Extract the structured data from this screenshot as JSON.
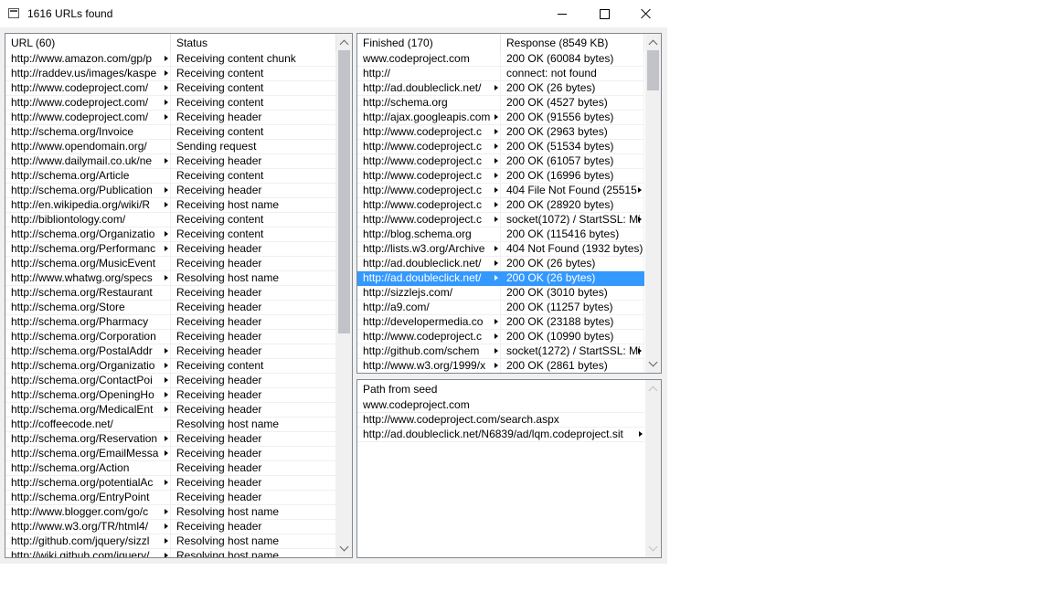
{
  "window": {
    "title": "1616 URLs found"
  },
  "in_progress": {
    "headers": [
      "URL (60)",
      "Status"
    ],
    "rows": [
      {
        "url": "http://www.amazon.com/gp/p",
        "status": "Receiving content chunk"
      },
      {
        "url": "http://raddev.us/images/kaspe",
        "status": "Receiving content"
      },
      {
        "url": "http://www.codeproject.com/",
        "status": "Receiving content"
      },
      {
        "url": "http://www.codeproject.com/",
        "status": "Receiving content"
      },
      {
        "url": "http://www.codeproject.com/",
        "status": "Receiving header"
      },
      {
        "url": "http://schema.org/Invoice",
        "status": "Receiving content"
      },
      {
        "url": "http://www.opendomain.org/",
        "status": "Sending request"
      },
      {
        "url": "http://www.dailymail.co.uk/ne",
        "status": "Receiving header"
      },
      {
        "url": "http://schema.org/Article",
        "status": "Receiving content"
      },
      {
        "url": "http://schema.org/Publication",
        "status": "Receiving header"
      },
      {
        "url": "http://en.wikipedia.org/wiki/R",
        "status": "Receiving host name"
      },
      {
        "url": "http://bibliontology.com/",
        "status": "Receiving content"
      },
      {
        "url": "http://schema.org/Organizatio",
        "status": "Receiving content"
      },
      {
        "url": "http://schema.org/Performanc",
        "status": "Receiving header"
      },
      {
        "url": "http://schema.org/MusicEvent",
        "status": "Receiving header"
      },
      {
        "url": "http://www.whatwg.org/specs",
        "status": "Resolving host name"
      },
      {
        "url": "http://schema.org/Restaurant",
        "status": "Receiving header"
      },
      {
        "url": "http://schema.org/Store",
        "status": "Receiving header"
      },
      {
        "url": "http://schema.org/Pharmacy",
        "status": "Receiving header"
      },
      {
        "url": "http://schema.org/Corporation",
        "status": "Receiving header"
      },
      {
        "url": "http://schema.org/PostalAddr",
        "status": "Receiving header"
      },
      {
        "url": "http://schema.org/Organizatio",
        "status": "Receiving content"
      },
      {
        "url": "http://schema.org/ContactPoi",
        "status": "Receiving header"
      },
      {
        "url": "http://schema.org/OpeningHo",
        "status": "Receiving header"
      },
      {
        "url": "http://schema.org/MedicalEnt",
        "status": "Receiving header"
      },
      {
        "url": "http://coffeecode.net/",
        "status": "Resolving host name"
      },
      {
        "url": "http://schema.org/Reservation",
        "status": "Receiving header"
      },
      {
        "url": "http://schema.org/EmailMessa",
        "status": "Receiving header"
      },
      {
        "url": "http://schema.org/Action",
        "status": "Receiving header"
      },
      {
        "url": "http://schema.org/potentialAc",
        "status": "Receiving header"
      },
      {
        "url": "http://schema.org/EntryPoint",
        "status": "Receiving header"
      },
      {
        "url": "http://www.blogger.com/go/c",
        "status": "Resolving host name"
      },
      {
        "url": "http://www.w3.org/TR/html4/",
        "status": "Receiving header"
      },
      {
        "url": "http://github.com/jquery/sizzl",
        "status": "Resolving host name"
      },
      {
        "url": "http://wiki.github.com/jquery/",
        "status": "Resolving host name"
      }
    ]
  },
  "finished": {
    "headers": [
      "Finished (170)",
      "Response (8549 KB)"
    ],
    "rows": [
      {
        "url": "www.codeproject.com",
        "response": "200 OK (60084 bytes)"
      },
      {
        "url": "http://",
        "response": "connect: not found"
      },
      {
        "url": "http://ad.doubleclick.net/",
        "response": "200 OK (26 bytes)"
      },
      {
        "url": "http://schema.org",
        "response": "200 OK (4527 bytes)"
      },
      {
        "url": "http://ajax.googleapis.com",
        "response": "200 OK (91556 bytes)"
      },
      {
        "url": "http://www.codeproject.c",
        "response": "200 OK (2963 bytes)"
      },
      {
        "url": "http://www.codeproject.c",
        "response": "200 OK (51534 bytes)"
      },
      {
        "url": "http://www.codeproject.c",
        "response": "200 OK (61057 bytes)"
      },
      {
        "url": "http://www.codeproject.c",
        "response": "200 OK (16996 bytes)"
      },
      {
        "url": "http://www.codeproject.c",
        "response": "404 File Not Found (25515"
      },
      {
        "url": "http://www.codeproject.c",
        "response": "200 OK (28920 bytes)"
      },
      {
        "url": "http://www.codeproject.c",
        "response": "socket(1072) / StartSSL: Mi"
      },
      {
        "url": "http://blog.schema.org",
        "response": "200 OK (115416 bytes)"
      },
      {
        "url": "http://lists.w3.org/Archive",
        "response": "404 Not Found (1932 bytes)"
      },
      {
        "url": "http://ad.doubleclick.net/",
        "response": "200 OK (26 bytes)"
      },
      {
        "url": "http://ad.doubleclick.net/",
        "response": "200 OK (26 bytes)"
      },
      {
        "url": "http://sizzlejs.com/",
        "response": "200 OK (3010 bytes)"
      },
      {
        "url": "http://a9.com/",
        "response": "200 OK (11257 bytes)"
      },
      {
        "url": "http://developermedia.co",
        "response": "200 OK (23188 bytes)"
      },
      {
        "url": "http://www.codeproject.c",
        "response": "200 OK (10990 bytes)"
      },
      {
        "url": "http://github.com/schem",
        "response": "socket(1272) / StartSSL: Mi"
      },
      {
        "url": "http://www.w3.org/1999/x",
        "response": "200 OK (2861 bytes)"
      }
    ]
  },
  "path": {
    "header": "Path from seed",
    "rows": [
      {
        "url": "www.codeproject.com"
      },
      {
        "url": "http://www.codeproject.com/search.aspx"
      },
      {
        "url": "http://ad.doubleclick.net/N6839/ad/lqm.codeproject.sit"
      }
    ]
  }
}
